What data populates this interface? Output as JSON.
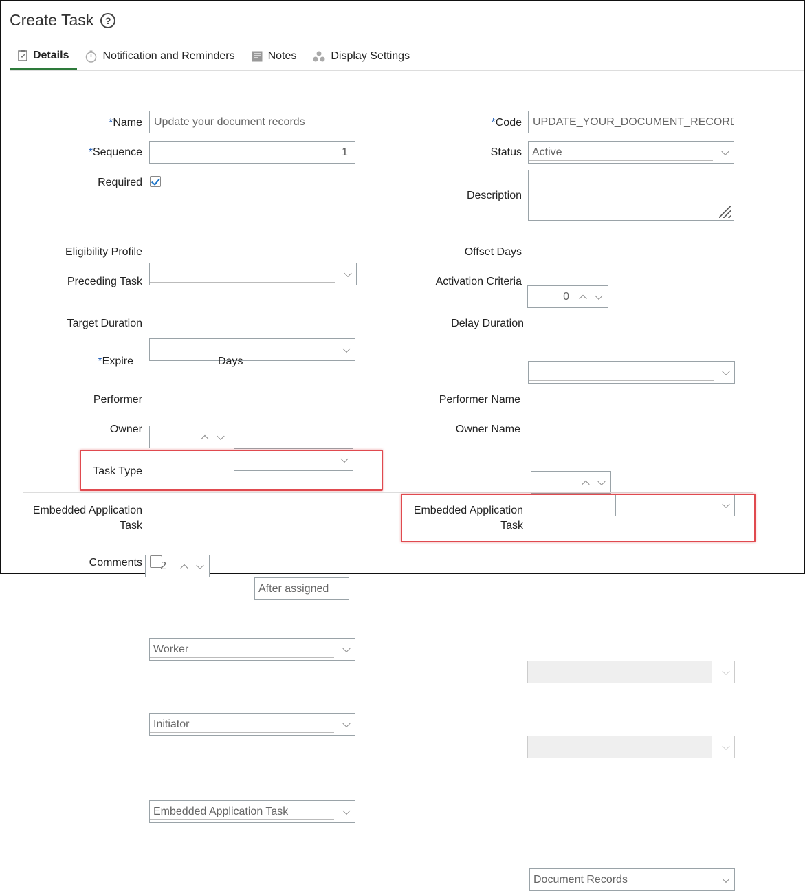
{
  "page": {
    "title": "Create Task"
  },
  "tabs": [
    {
      "label": "Details"
    },
    {
      "label": "Notification and Reminders"
    },
    {
      "label": "Notes"
    },
    {
      "label": "Display Settings"
    }
  ],
  "form": {
    "name": {
      "label": "Name",
      "value": "Update your document records"
    },
    "code": {
      "label": "Code",
      "value": "UPDATE_YOUR_DOCUMENT_RECORDS"
    },
    "sequence": {
      "label": "Sequence",
      "value": "1"
    },
    "status": {
      "label": "Status",
      "value": "Active"
    },
    "required": {
      "label": "Required",
      "checked": true
    },
    "description": {
      "label": "Description",
      "value": ""
    },
    "eligibility_profile": {
      "label": "Eligibility Profile",
      "value": ""
    },
    "offset_days": {
      "label": "Offset Days",
      "value": "0"
    },
    "preceding_task": {
      "label": "Preceding Task",
      "value": ""
    },
    "activation_criteria": {
      "label": "Activation Criteria",
      "value": ""
    },
    "target_duration": {
      "label": "Target Duration",
      "value": "",
      "unit": ""
    },
    "delay_duration": {
      "label": "Delay Duration",
      "value": "",
      "unit": ""
    },
    "expire": {
      "label": "Expire",
      "value": "2",
      "unit_label": "Days",
      "relative": "After assigned"
    },
    "performer": {
      "label": "Performer",
      "value": "Worker"
    },
    "performer_name": {
      "label": "Performer Name",
      "value": ""
    },
    "owner": {
      "label": "Owner",
      "value": "Initiator"
    },
    "owner_name": {
      "label": "Owner Name",
      "value": ""
    },
    "task_type": {
      "label": "Task Type",
      "value": "Embedded Application Task"
    },
    "embedded_left": {
      "label_line1": "Embedded Application",
      "label_line2": "Task"
    },
    "embedded_right": {
      "label_line1": "Embedded Application",
      "label_line2": "Task",
      "value": "Document Records"
    },
    "comments": {
      "label": "Comments",
      "checked": false
    }
  },
  "required_marker": "*",
  "colors": {
    "highlight": "#e04a4f",
    "active_tab": "#2d7a3a",
    "required": "#1a5bb8",
    "check": "#1a73c8"
  }
}
